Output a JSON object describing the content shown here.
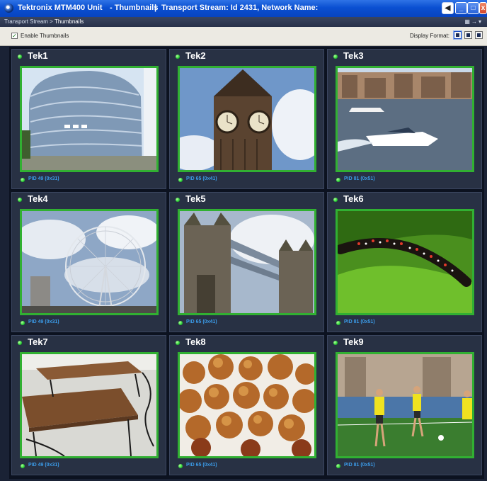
{
  "window": {
    "app_title": "Tektronix MTM400 Unit",
    "view_name": "- Thumbnails",
    "separator": "|",
    "stream_info": "Transport Stream: Id 2431, Network Name:"
  },
  "breadcrumb": {
    "parent": "Transport Stream",
    "sep": " > ",
    "current": "Thumbnails"
  },
  "toolbar": {
    "enable_thumbnails_label": "Enable Thumbnails",
    "enable_thumbnails_checked": true,
    "display_format_label": "Display Format:"
  },
  "thumbnails": [
    {
      "name": "Tek1",
      "pid": "PID 49 (0x31)",
      "image": "modern-glass-building"
    },
    {
      "name": "Tek2",
      "pid": "PID 65 (0x41)",
      "image": "clock-tower"
    },
    {
      "name": "Tek3",
      "pid": "PID 81 (0x51)",
      "image": "speedboats-on-river"
    },
    {
      "name": "Tek4",
      "pid": "PID 49 (0x31)",
      "image": "ferris-wheel"
    },
    {
      "name": "Tek5",
      "pid": "PID 65 (0x41)",
      "image": "tower-bridge"
    },
    {
      "name": "Tek6",
      "pid": "PID 81 (0x51)",
      "image": "caterpillar-on-leaf"
    },
    {
      "name": "Tek7",
      "pid": "PID 49 (0x31)",
      "image": "wooden-tables"
    },
    {
      "name": "Tek8",
      "pid": "PID 65 (0x41)",
      "image": "fried-food"
    },
    {
      "name": "Tek9",
      "pid": "PID 81 (0x51)",
      "image": "soccer-players"
    }
  ],
  "colors": {
    "status_led": "#2fd43b",
    "thumbnail_border": "#31b032",
    "pid_text": "#3b9be8"
  }
}
